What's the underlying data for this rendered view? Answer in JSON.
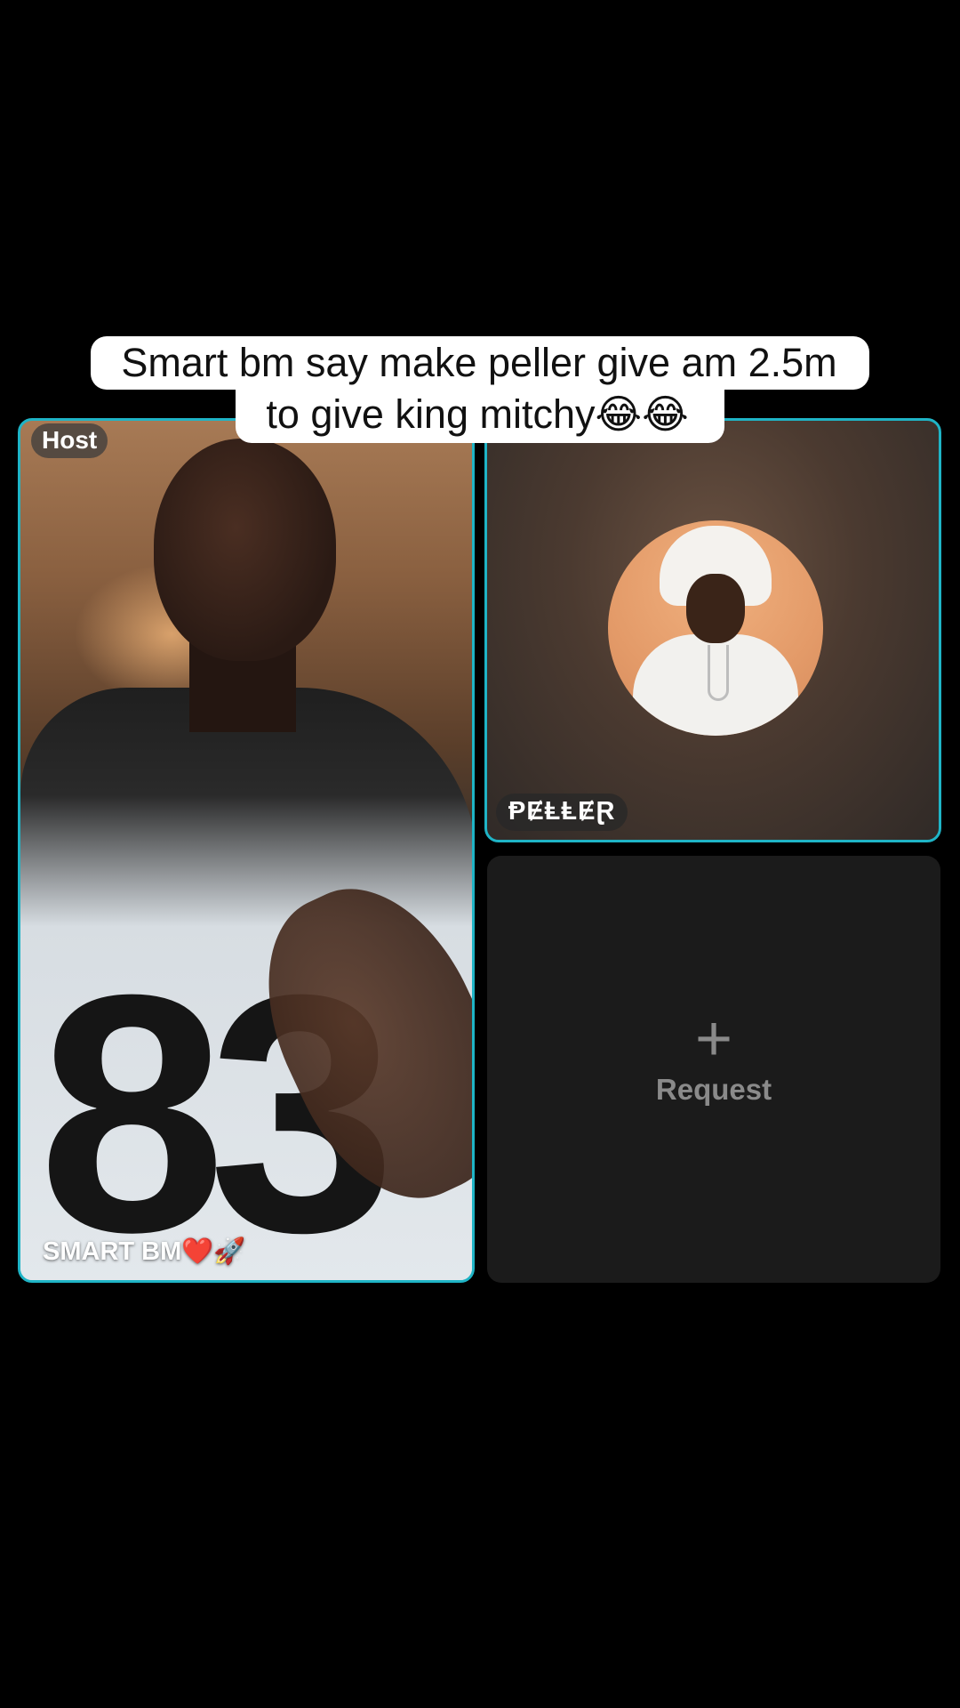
{
  "caption": {
    "line1": "Smart bm say make peller give am 2.5m",
    "line2": "to give king mitchy😂😂"
  },
  "host_tile": {
    "badge": "Host",
    "name": "SMART BM❤️🚀"
  },
  "guest_tile": {
    "name": "ⱣɆⱠⱠɆⱤ"
  },
  "request_tile": {
    "icon": "plus-icon",
    "label": "Request"
  },
  "colors": {
    "active_border": "#1fb4c6",
    "request_bg": "#1b1b1b",
    "caption_bg": "#ffffff"
  }
}
